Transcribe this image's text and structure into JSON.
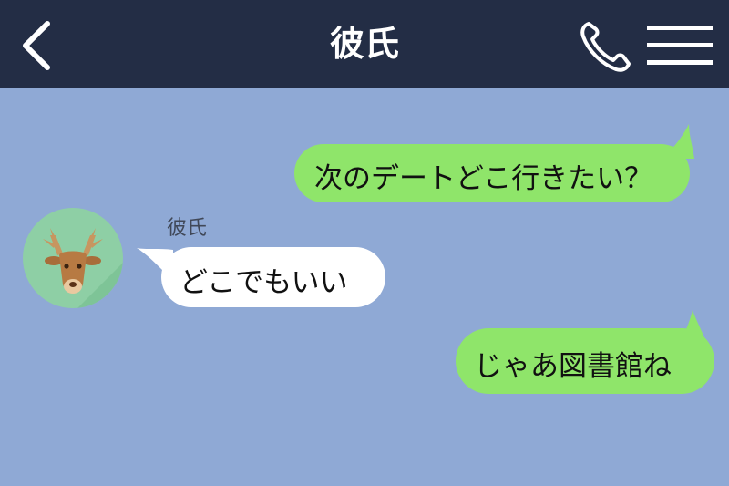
{
  "header": {
    "title": "彼氏",
    "back_icon": "chevron-left-icon",
    "call_icon": "phone-icon",
    "menu_icon": "menu-icon"
  },
  "colors": {
    "header_bg": "#232d45",
    "chat_bg": "#8fa9d5",
    "outgoing_bubble": "#8fe56a",
    "incoming_bubble": "#ffffff"
  },
  "messages": [
    {
      "direction": "outgoing",
      "text": "次のデートどこ行きたい？"
    },
    {
      "direction": "incoming",
      "sender": "彼氏",
      "avatar_icon": "deer-icon",
      "text": "どこでもいい"
    },
    {
      "direction": "outgoing",
      "text": "じゃあ図書館ね"
    }
  ]
}
